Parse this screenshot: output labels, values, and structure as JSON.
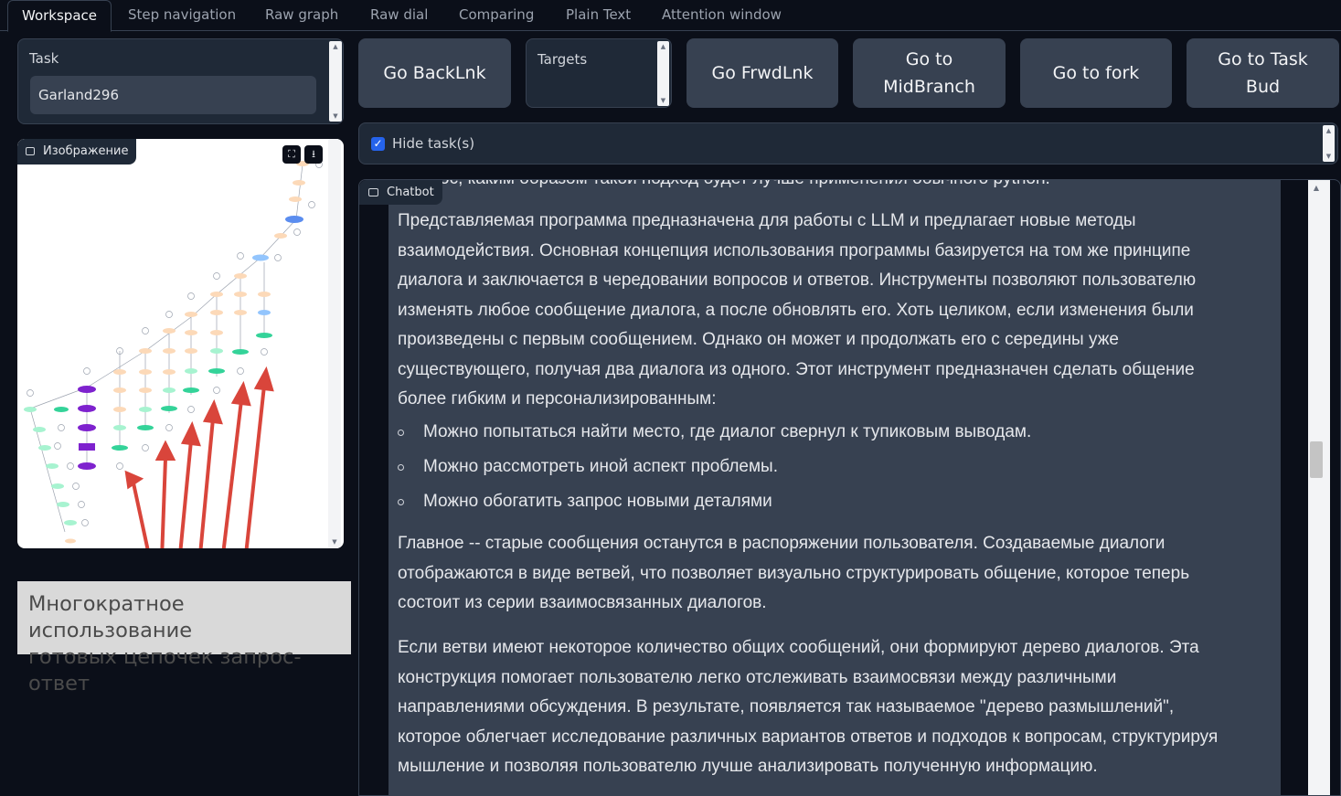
{
  "tabs": [
    "Workspace",
    "Step navigation",
    "Raw graph",
    "Raw dial",
    "Comparing",
    "Plain Text",
    "Attention window"
  ],
  "task": {
    "label": "Task",
    "value": "Garland296"
  },
  "targets": {
    "label": "Targets"
  },
  "buttons": {
    "back": "Go BackLnk",
    "forward": "Go FrwdLnk",
    "mid_line1": "Go to",
    "mid_line2": "MidBranch",
    "fork": "Go to fork",
    "bud_line1": "Go to Task",
    "bud_line2": "Bud"
  },
  "image_panel": {
    "label": "Изображение"
  },
  "caption": {
    "line1": "Многократное использование",
    "line2": "готовых цепочек запрос-ответ"
  },
  "hide_tasks": {
    "label": "Hide task(s)",
    "checked": true
  },
  "chatbot": {
    "label": "Chatbot",
    "cut_line": "ос, каким образом такой подход будет лучше применения обычного python.",
    "p1_lines": [
      "Представляемая программа предназначена для работы с LLM и предлагает новые методы",
      "взаимодействия. Основная концепция использования программы базируется на том же принципе",
      "диалога и заключается в чередовании вопросов и ответов. Инструменты позволяют пользователю",
      "изменять любое сообщение диалога, а после обновлять его. Хоть целиком, если изменения были",
      "произведены с первым сообщением. Однако он может и продолжать его с середины уже",
      "существующего, получая два диалога из одного. Этот инструмент предназначен сделать общение",
      "более гибким и персонализированным:"
    ],
    "bullets": [
      "Можно попытаться найти место, где диалог свернул к тупиковым выводам.",
      "Можно рассмотреть иной аспект проблемы.",
      "Можно обогатить запрос новыми деталями"
    ],
    "p2_lines": [
      "Главное -- старые сообщения останутся в распоряжении пользователя. Создаваемые диалоги",
      "отображаются в виде ветвей, что позволяет визуально структурировать общение, которое теперь",
      "состоит из серии взаимосвязанных диалогов."
    ],
    "p3_lines": [
      "Если ветви имеют некоторое количество общих сообщений, они формируют дерево диалогов. Эта",
      "конструкция помогает пользователю легко отслеживать взаимосвязи между различными",
      "направлениями обсуждения. В результате, появляется так называемое \"дерево размышлений\",",
      "которое облегчает исследование различных вариантов ответов и подходов к вопросам, структурируя",
      "мышление и позволяя пользователю лучше анализировать полученную информацию."
    ]
  }
}
